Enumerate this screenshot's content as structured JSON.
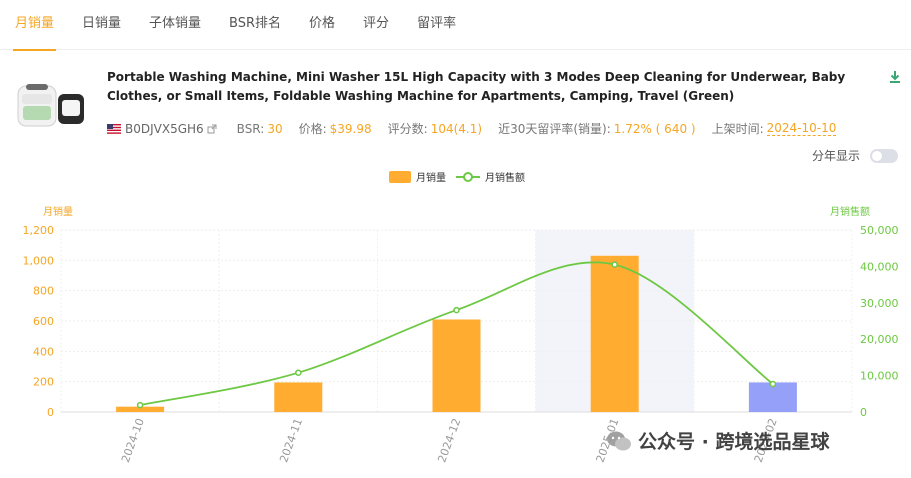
{
  "tabs": [
    {
      "label": "月销量",
      "active": true
    },
    {
      "label": "日销量",
      "active": false
    },
    {
      "label": "子体销量",
      "active": false
    },
    {
      "label": "BSR排名",
      "active": false
    },
    {
      "label": "价格",
      "active": false
    },
    {
      "label": "评分",
      "active": false
    },
    {
      "label": "留评率",
      "active": false
    }
  ],
  "product": {
    "title": "Portable Washing Machine, Mini Washer 15L High Capacity with 3 Modes Deep Cleaning for Underwear, Baby Clothes, or Small Items, Foldable Washing Machine for Apartments, Camping, Travel (Green)",
    "asin": "B0DJVX5GH6",
    "bsr_label": "BSR:",
    "bsr": "30",
    "price_label": "价格:",
    "price": "$39.98",
    "reviews_label": "评分数:",
    "reviews": "104(4.1)",
    "review_rate_label": "近30天留评率(销量):",
    "review_rate": "1.72% ( 640 )",
    "launch_label": "上架时间:",
    "launch_date": "2024-10-10"
  },
  "year_toggle_label": "分年显示",
  "watermark": "公众号 · 跨境选品星球",
  "chart_data": {
    "type": "bar",
    "categories": [
      "2024-10",
      "2024-11",
      "2024-12",
      "2025-01",
      "2025-02"
    ],
    "series": [
      {
        "name": "月销量",
        "type": "bar",
        "axis": "left",
        "values": [
          35,
          195,
          610,
          1030,
          195
        ],
        "color": "#ffac30",
        "last_bar_color": "#95a0f8"
      },
      {
        "name": "月销售额",
        "type": "line",
        "axis": "right",
        "values": [
          1900,
          10800,
          28000,
          40500,
          7700
        ],
        "color": "#6dc843"
      }
    ],
    "ylabel": "月销量",
    "ylabel_right": "月销售额",
    "ylim": [
      0,
      1200
    ],
    "ylim_right": [
      0,
      50000
    ],
    "yticks": [
      "0",
      "200",
      "400",
      "600",
      "800",
      "1,000",
      "1,200"
    ],
    "yticks_right": [
      "0",
      "10,000",
      "20,000",
      "30,000",
      "40,000",
      "50,000"
    ],
    "highlight_category": "2025-01",
    "grid": true,
    "legend": "top-center"
  }
}
